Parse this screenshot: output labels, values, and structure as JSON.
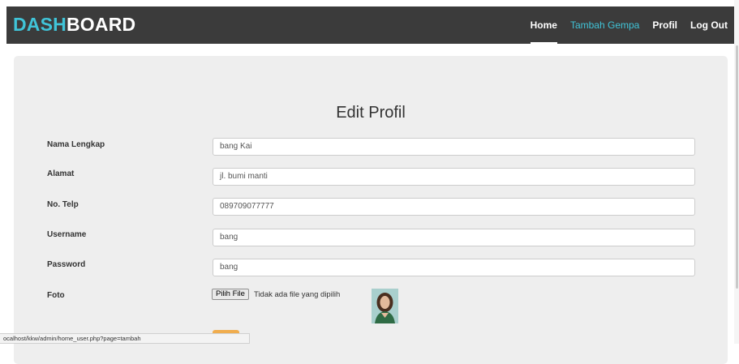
{
  "brand": {
    "part1": "DASH",
    "part2": "BOARD"
  },
  "nav": {
    "home": "Home",
    "tambah_gempa": "Tambah Gempa",
    "profil": "Profil",
    "logout": "Log Out"
  },
  "colors": {
    "accent": "#40c4d8",
    "navbar": "#3b3b3b",
    "panel": "#eeeeee",
    "button": "#f0ad4e"
  },
  "form": {
    "title": "Edit Profil",
    "fields": [
      {
        "label": "Nama Lengkap",
        "value": "bang Kai"
      },
      {
        "label": "Alamat",
        "value": "jl. bumi manti"
      },
      {
        "label": "No. Telp",
        "value": "089709077777"
      },
      {
        "label": "Username",
        "value": "bang"
      },
      {
        "label": "Password",
        "value": "bang"
      }
    ],
    "foto_label": "Foto",
    "file_button": "Pilih File",
    "file_status": "Tidak ada file yang dipilih"
  },
  "status_url": "ocalhost/kkw/admin/home_user.php?page=tambah"
}
